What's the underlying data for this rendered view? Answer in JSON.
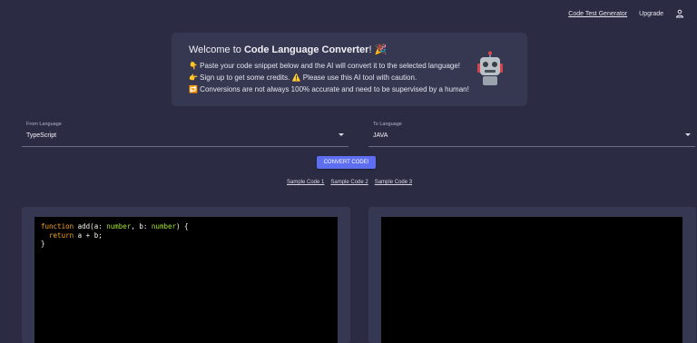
{
  "nav": {
    "code_test_generator": "Code Test Generator",
    "upgrade": "Upgrade",
    "user_icon": "user-icon"
  },
  "welcome": {
    "title_prefix": "Welcome to ",
    "title_bold": "Code Language Converter",
    "title_suffix": "! 🎉",
    "line1": "👇 Paste your code snippet below and the AI will convert it to the selected language!",
    "line2": "👉 Sign up to get some credits. ⚠️ Please use this AI tool with caution.",
    "line3": "🔁 Conversions are not always 100% accurate and need to be supervised by a human!",
    "robot_icon": "robot-icon"
  },
  "from_language": {
    "label": "From Language",
    "value": "TypeScript"
  },
  "to_language": {
    "label": "To Language",
    "value": "JAVA"
  },
  "convert_button": "CONVERT CODE!",
  "samples": [
    "Sample Code 1",
    "Sample Code 2",
    "Sample Code 3"
  ],
  "input_code": {
    "line1": {
      "kw": "function",
      "fn": " add(a: ",
      "t1": "number",
      "mid": ", b: ",
      "t2": "number",
      "end": ") {"
    },
    "line2": {
      "kw": "return",
      "rest": " a + b;"
    },
    "line3": "}"
  },
  "output_code": "",
  "colors": {
    "background": "#2b2c44",
    "card": "#363852",
    "accent": "#5d6ef0"
  }
}
